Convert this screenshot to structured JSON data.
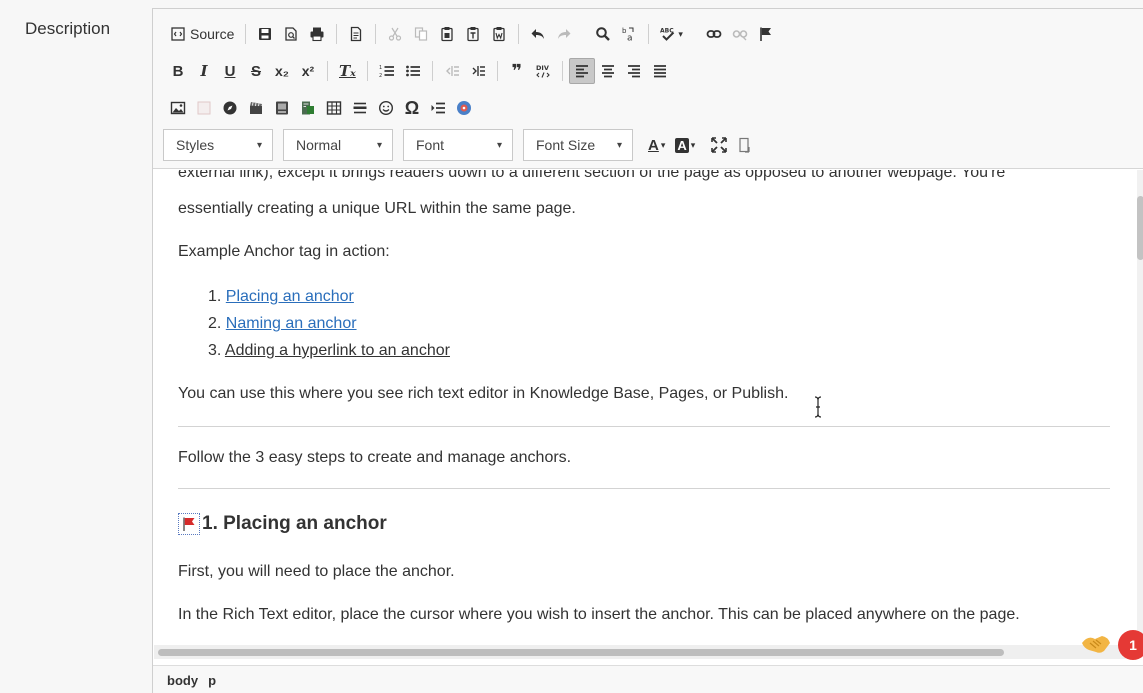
{
  "field": {
    "label": "Description"
  },
  "toolbar": {
    "source_label": "Source",
    "styles_label": "Styles",
    "format_label": "Normal",
    "font_label": "Font",
    "size_label": "Font Size",
    "abc_label": "ABC",
    "div_label": "DIV",
    "bold": "B",
    "italic": "I",
    "underline": "U",
    "strike": "S",
    "sub": "x₂",
    "sup": "x²",
    "removefmt": "Tₓ",
    "quote": "❞",
    "omega": "Ω",
    "textcolor": "A",
    "bgcolor": "A"
  },
  "content": {
    "cut_line": "external link), except it brings readers down to a different section of the page as opposed to another webpage. You're",
    "para_unique": "essentially creating a unique URL within the same page.",
    "para_example": "Example Anchor tag in action:",
    "list": [
      {
        "num": "1.",
        "text": "Placing an anchor"
      },
      {
        "num": "2.",
        "text": "Naming an anchor"
      },
      {
        "num": "3.",
        "text": "Adding a hyperlink to an anchor"
      }
    ],
    "para_use": "You can use this where you see rich text editor in Knowledge Base, Pages, or Publish.",
    "para_follow": "Follow the 3 easy steps to create and manage anchors.",
    "heading1": "1. Placing an anchor",
    "para_first": "First, you will need to place the anchor.",
    "para_rte": "In the Rich Text editor, place the cursor where you wish to insert the anchor. This can be placed anywhere on the page."
  },
  "statusbar": {
    "path": [
      "body",
      "p"
    ]
  },
  "notification": {
    "count": "1"
  },
  "colors": {
    "link": "#2a6ebb",
    "badge": "#e53935",
    "flag": "#d62b2b"
  }
}
